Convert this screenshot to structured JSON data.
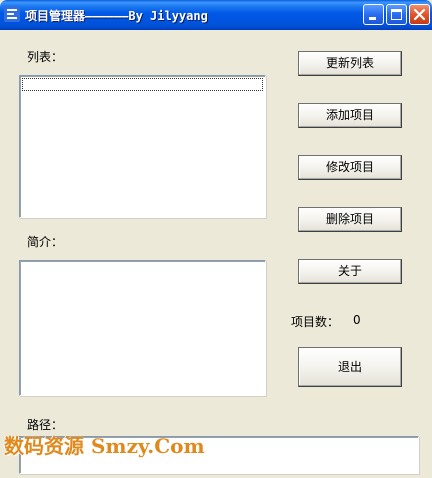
{
  "window": {
    "title": "项目管理器——————By Jilyyang",
    "icon": "app-logo-icon",
    "controls": [
      "minimize-icon",
      "maximize-icon",
      "close-icon"
    ]
  },
  "labels": {
    "list": "列表：",
    "description": "简介：",
    "path": "路径：",
    "project_count": "项目数："
  },
  "project_count_value": "0",
  "buttons": {
    "refresh_list": "更新列表",
    "add_project": "添加项目",
    "modify_project": "修改项目",
    "delete_project": "删除项目",
    "about": "关于",
    "exit": "退出"
  },
  "list_items": [],
  "description_text": "",
  "path_text": "",
  "watermark": "数码资源 Smzy.Com",
  "colors": {
    "window_bg": "#ece9d8",
    "titlebar": "#0055df",
    "close_button": "#e0552a",
    "watermark": "#e08a1e"
  }
}
